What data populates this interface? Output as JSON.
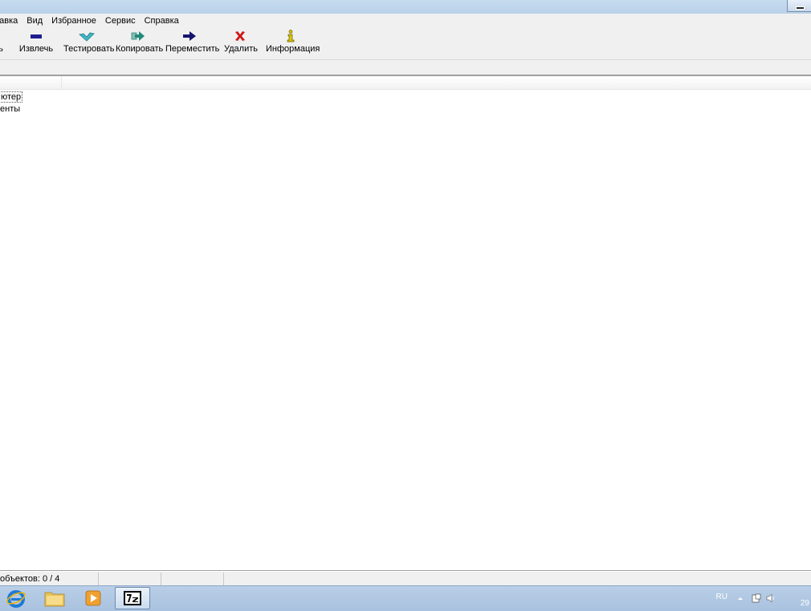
{
  "menu": [
    "равка",
    "Вид",
    "Избранное",
    "Сервис",
    "Справка"
  ],
  "toolbar": {
    "partial_label": "ь",
    "extract": "Извлечь",
    "test": "Тестировать",
    "copy": "Копировать",
    "move": "Переместить",
    "delete": "Удалить",
    "info": "Информация"
  },
  "list": {
    "items": [
      "ютер",
      "енты"
    ]
  },
  "status": {
    "selected": "объектов: 0 / 4"
  },
  "taskbar": {
    "language": "RU",
    "clock": "29"
  },
  "colors": {
    "extract": "#1f1f8f",
    "test": "#3fb6c6",
    "copy": "#1f8a7a",
    "move": "#14146e",
    "delete": "#d01818",
    "info": "#d8c400"
  }
}
